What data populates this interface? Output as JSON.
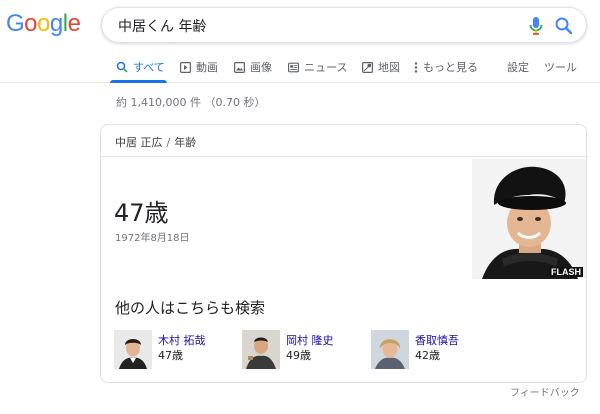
{
  "logo": {
    "letters": [
      "G",
      "o",
      "o",
      "g",
      "l",
      "e"
    ],
    "colors": [
      "#4285F4",
      "#EA4335",
      "#FBBC05",
      "#4285F4",
      "#34A853",
      "#EA4335"
    ]
  },
  "search": {
    "query": "中居くん 年齢"
  },
  "tabs": [
    {
      "label": "すべて",
      "icon": "search-icon",
      "active": true
    },
    {
      "label": "動画",
      "icon": "video-icon"
    },
    {
      "label": "画像",
      "icon": "image-icon"
    },
    {
      "label": "ニュース",
      "icon": "news-icon"
    },
    {
      "label": "地図",
      "icon": "map-icon"
    },
    {
      "label": "もっと見る",
      "icon": "more-icon"
    }
  ],
  "tools": {
    "settings": "設定",
    "tools": "ツール"
  },
  "result_stats": "約 1,410,000 件 （0.70 秒）",
  "card": {
    "breadcrumb": {
      "entity": "中居 正広",
      "attribute": "年齢"
    },
    "answer": "47歳",
    "answer_sub": "1972年8月18日",
    "image_watermark": "FLASH",
    "pasf_title": "他の人はこちらも検索",
    "people": [
      {
        "name": "木村 拓哉",
        "age": "47歳"
      },
      {
        "name": "岡村 隆史",
        "age": "49歳"
      },
      {
        "name": "香取慎吾",
        "age": "42歳"
      }
    ]
  },
  "feedback": "フィードバック",
  "colors": {
    "accent": "#1a73e8",
    "link": "#1a0dab",
    "muted": "#70757a"
  }
}
